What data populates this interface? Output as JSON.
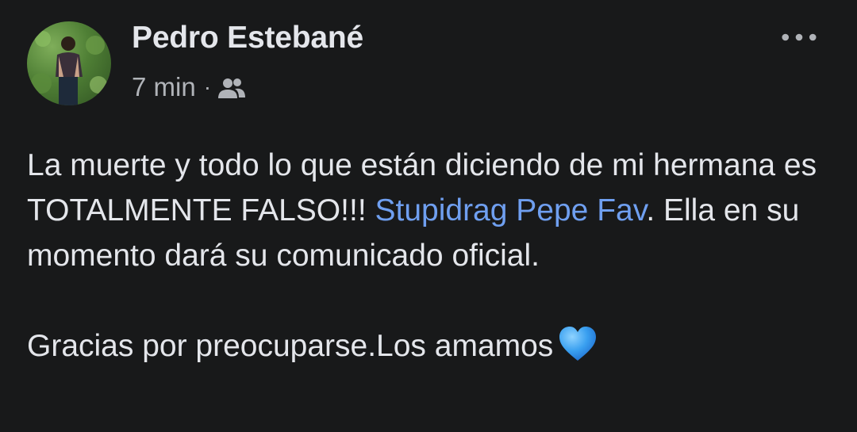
{
  "post": {
    "author_name": "Pedro Estebané",
    "timestamp": "7 min",
    "separator": "·",
    "audience_icon": "friends-icon",
    "more_icon": "more-options-icon",
    "body": {
      "line1_text": "La muerte y todo lo que están diciendo de mi hermana es TOTALMENTE FALSO!!! ",
      "mention": "Stupidrag Pepe Fav",
      "line1_after": ". Ella en su momento dará su comunicado oficial.",
      "line2_text": "Gracias por preocuparse.Los amamos",
      "emoji": "blue-heart-icon"
    }
  },
  "colors": {
    "background": "#18191a",
    "primary_text": "#e4e6eb",
    "secondary_text": "#b0b3b8",
    "mention": "#6f9ff0",
    "heart": "#3aa0f0"
  }
}
